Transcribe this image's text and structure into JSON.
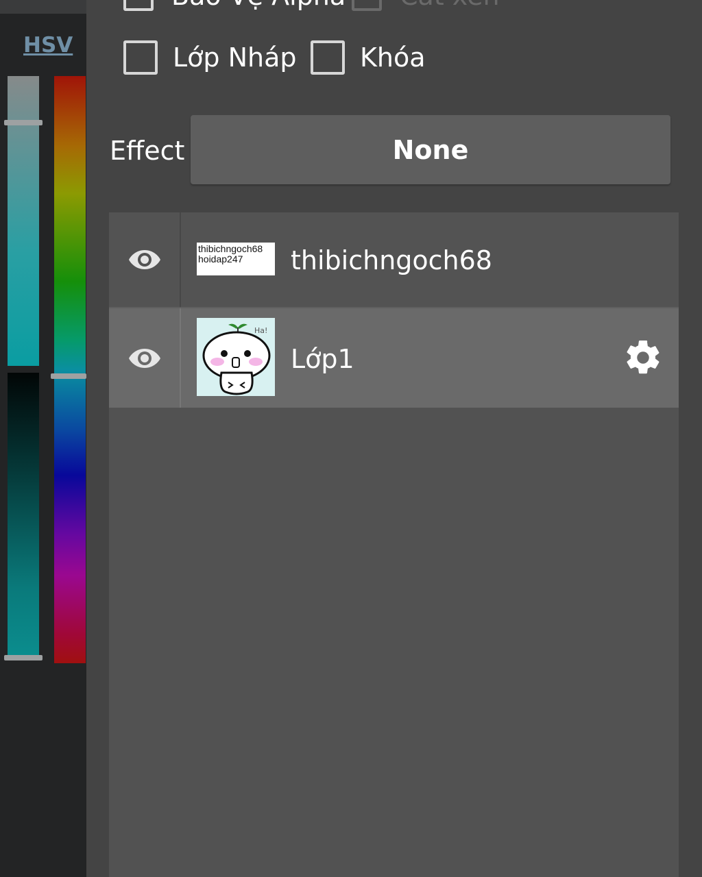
{
  "color_panel": {
    "mode_link": "HSV"
  },
  "options": {
    "alpha_protect": {
      "label": "Bảo Vệ Alpha",
      "checked": false
    },
    "clip": {
      "label": "Cắt xén",
      "checked": false,
      "enabled": false
    },
    "draft_layer": {
      "label": "Lớp Nháp",
      "checked": false
    },
    "lock": {
      "label": "Khóa",
      "checked": false
    }
  },
  "effect": {
    "label": "Effect",
    "value": "None"
  },
  "layers": [
    {
      "name": "thibichngoch68",
      "visible": true,
      "thumb_text": [
        "thibichngoch68",
        "hoidap247"
      ],
      "selected": false
    },
    {
      "name": "Lớp1",
      "visible": true,
      "thumb_text": [
        "Ha!"
      ],
      "selected": true
    }
  ],
  "icons": {
    "visibility": "eye-icon",
    "settings": "gear-icon"
  }
}
